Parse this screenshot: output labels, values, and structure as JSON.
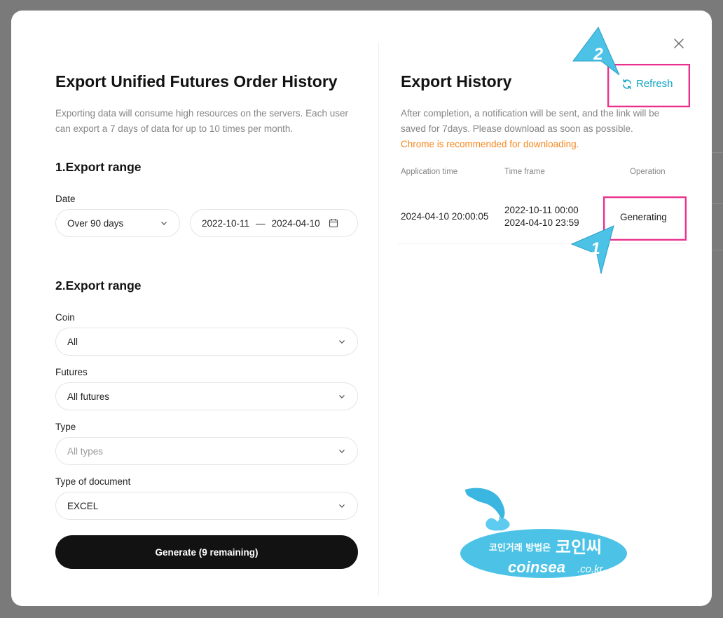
{
  "left": {
    "title": "Export Unified Futures Order History",
    "description": "Exporting data will consume high resources on the servers. Each user can export a 7 days of data for up to 10 times per month.",
    "section1_title": "1.Export range",
    "date_label": "Date",
    "date_preset": "Over 90 days",
    "date_start": "2022-10-11",
    "date_separator": "—",
    "date_end": "2024-04-10",
    "section2_title": "2.Export range",
    "coin_label": "Coin",
    "coin_value": "All",
    "futures_label": "Futures",
    "futures_value": "All futures",
    "type_label": "Type",
    "type_placeholder": "All types",
    "doc_label": "Type of document",
    "doc_value": "EXCEL",
    "generate_label": "Generate (9 remaining)"
  },
  "right": {
    "title": "Export History",
    "refresh_label": "Refresh",
    "description": "After completion, a notification will be sent, and the link will be saved for 7days. Please download as soon as possible.",
    "warning": "Chrome is recommended for downloading.",
    "columns": [
      "Application time",
      "Time frame",
      "Operation"
    ],
    "rows": [
      {
        "application_time": "2024-04-10 20:00:05",
        "time_frame_start": "2022-10-11 00:00",
        "time_frame_end": "2024-04-10 23:59",
        "operation": "Generating"
      }
    ]
  },
  "annotations": {
    "callout_1": "1",
    "callout_2": "2"
  },
  "watermark": {
    "korean_text": "코인거래 방법은",
    "korean_brand": "코인씨",
    "latin_brand": "coinsea",
    "domain_suffix": ".co.kr"
  },
  "colors": {
    "accent": "#0fa5c4",
    "warning": "#f7871e",
    "highlight_border": "#e8308c",
    "primary_button": "#121212",
    "callout_fill": "#4cc3e6"
  },
  "icons": [
    "close-icon",
    "refresh-icon",
    "chevron-down-icon",
    "calendar-icon"
  ]
}
